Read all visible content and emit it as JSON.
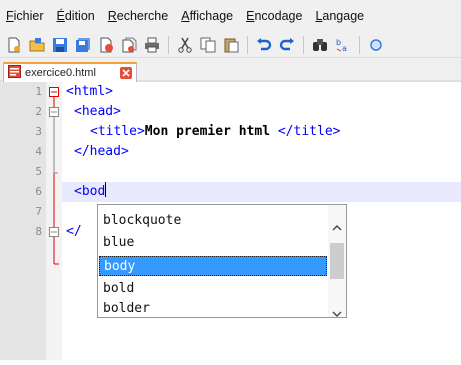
{
  "menu": {
    "items": [
      {
        "first": "F",
        "rest": "ichier"
      },
      {
        "first": "É",
        "rest": "dition"
      },
      {
        "first": "R",
        "rest": "echerche"
      },
      {
        "first": "A",
        "rest": "ffichage"
      },
      {
        "first": "E",
        "rest": "ncodage"
      },
      {
        "first": "L",
        "rest": "angage"
      }
    ]
  },
  "tab": {
    "filename": "exercice0.html"
  },
  "editor": {
    "line_numbers": [
      "1",
      "2",
      "3",
      "4",
      "5",
      "6",
      "7",
      "8"
    ],
    "lines": {
      "l1_tag": "<html>",
      "l2_tag": "<head>",
      "l3_open": "<title>",
      "l3_text": "Mon premier html ",
      "l3_close": "</title>",
      "l4_tag": "</head>",
      "l5_typed": "<bod",
      "l7_tag": "</"
    }
  },
  "autocomplete": {
    "items": [
      "blockquote",
      "blue",
      "body",
      "bold",
      "bolder"
    ],
    "selected_index": 2
  },
  "colors": {
    "tag": "#0000ff",
    "selection": "#3399ff",
    "tab_accent": "#f3a23c"
  }
}
